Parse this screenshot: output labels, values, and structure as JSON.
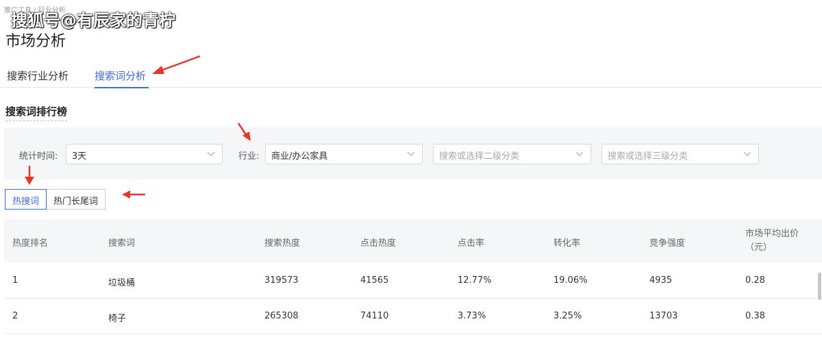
{
  "breadcrumb": "推广工具 / 行业分析",
  "watermark": "搜狐号@有辰家的青柠",
  "page_title": "市场分析",
  "tabs": [
    {
      "label": "搜索行业分析",
      "active": false
    },
    {
      "label": "搜索词分析",
      "active": true
    }
  ],
  "section_title": "搜索词排行榜",
  "filters": {
    "time_label": "统计时间:",
    "time_value": "3天",
    "industry_label": "行业:",
    "industry_value": "商业/办公家具",
    "level2_placeholder": "搜索或选择二级分类",
    "level3_placeholder": "搜索或选择三级分类"
  },
  "word_type": {
    "options": [
      "热搜词",
      "热门长尾词"
    ],
    "selected": "热搜词"
  },
  "table": {
    "headers": [
      "热度排名",
      "搜索词",
      "搜索热度",
      "点击热度",
      "点击率",
      "转化率",
      "竞争强度",
      "市场平均出价（元）"
    ],
    "rows": [
      [
        "1",
        "垃圾桶",
        "319573",
        "41565",
        "12.77%",
        "19.06%",
        "4935",
        "0.28"
      ],
      [
        "2",
        "椅子",
        "265308",
        "74110",
        "3.73%",
        "3.25%",
        "13703",
        "0.38"
      ]
    ]
  },
  "colors": {
    "accent": "#3f6ad8",
    "annotation_arrow": "#e8352b",
    "filter_bg": "#f5f6f8"
  }
}
